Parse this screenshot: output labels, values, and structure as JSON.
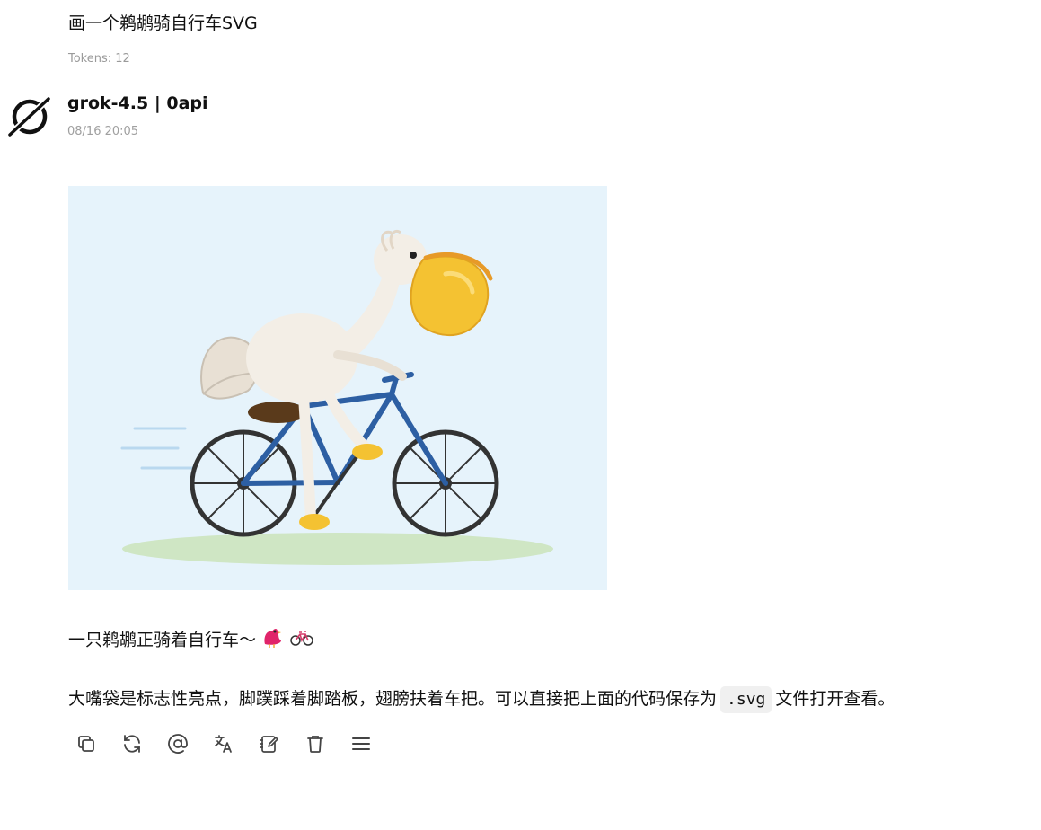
{
  "user": {
    "message": "画一个鹈鹕骑自行车SVG",
    "tokens_label": "Tokens: 12"
  },
  "assistant": {
    "model_name": "grok-4.5 | 0api",
    "timestamp": "08/16 20:05",
    "avatar_icon": "grok-logo-icon",
    "image": {
      "subject": "pelican-riding-bicycle-illustration",
      "background_color": "#e6f3fb"
    },
    "line1": "一只鹈鹕正骑着自行车～",
    "line1_emojis": [
      "bird-emoji",
      "bicycle-emoji"
    ],
    "line2_before": "大嘴袋是标志性亮点，脚蹼踩着脚踏板，翅膀扶着车把。可以直接把上面的代码保存为",
    "line2_code": ".svg",
    "line2_after": "文件打开查看。"
  },
  "actions": [
    {
      "name": "copy-icon"
    },
    {
      "name": "regenerate-icon"
    },
    {
      "name": "mention-icon"
    },
    {
      "name": "translate-icon"
    },
    {
      "name": "edit-icon"
    },
    {
      "name": "delete-icon"
    },
    {
      "name": "menu-icon"
    }
  ]
}
